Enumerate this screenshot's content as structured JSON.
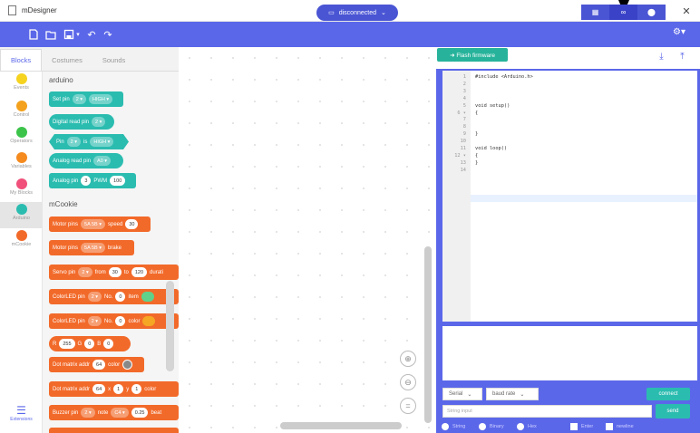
{
  "window": {
    "title": "mDesigner",
    "controls": [
      "–",
      "☐",
      "✕"
    ]
  },
  "toolbar": {
    "connection_label": "disconnected",
    "modes": [
      "▦",
      "∞",
      "⬤"
    ],
    "accent": "#5b67e9"
  },
  "left_tabs": [
    "Blocks",
    "Costumes",
    "Sounds"
  ],
  "categories": [
    {
      "label": "Events",
      "color": "#f5d31f"
    },
    {
      "label": "Control",
      "color": "#f4a11d"
    },
    {
      "label": "Operators",
      "color": "#3cc44a"
    },
    {
      "label": "Variables",
      "color": "#f58a1f"
    },
    {
      "label": "My Blocks",
      "color": "#f0507a"
    },
    {
      "label": "Arduino",
      "color": "#2bbcb0"
    },
    {
      "label": "mCookie",
      "color": "#f26a2a"
    }
  ],
  "extensions_label": "Extensions",
  "palette": {
    "section_arduino": "arduino",
    "section_mcookie": "mCookie",
    "blocks": {
      "set_pin": {
        "text": "Set pin",
        "pin": "2 ▾",
        "level": "HIGH ▾"
      },
      "digital_read": {
        "text": "Digital read pin",
        "pin": "2 ▾"
      },
      "pin_is": {
        "text": "Pin",
        "pin": "2 ▾",
        "is": "is",
        "level": "HIGH ▾"
      },
      "analog_read": {
        "text": "Analog read pin",
        "pin": "A0 ▾"
      },
      "analog_pwm": {
        "text": "Analog pin",
        "pin": "3",
        "pwm": "PWM",
        "val": "100"
      },
      "motor_speed": {
        "text": "Motor pins",
        "pins": "5A 5B ▾",
        "speed": "speed",
        "val": "30"
      },
      "motor_brake": {
        "text": "Motor pins",
        "pins": "5A 5B ▾",
        "brake": "brake"
      },
      "servo": {
        "text": "Servo pin",
        "pin": "2 ▾",
        "from": "from",
        "a": "30",
        "to": "to",
        "b": "120",
        "dur": "durati"
      },
      "color_led_item": {
        "text": "ColorLED pin",
        "pin": "2 ▾",
        "no": "No.",
        "n": "0",
        "item": "item"
      },
      "color_led_color": {
        "text": "ColorLED pin",
        "pin": "2 ▾",
        "no": "No.",
        "n": "0",
        "color": "color"
      },
      "rgb": {
        "r_lbl": "R",
        "r": "255",
        "g_lbl": "G",
        "g": "0",
        "b_lbl": "B",
        "b": "0"
      },
      "dot_matrix_color": {
        "text": "Dot matrix addr",
        "addr": "64",
        "color": "color"
      },
      "dot_matrix_xy": {
        "text": "Dot matrix addr",
        "addr": "64",
        "x_lbl": "x",
        "x": "1",
        "y_lbl": "y",
        "y": "1",
        "color": "color"
      },
      "buzzer": {
        "text": "Buzzer pin",
        "pin": "2 ▾",
        "note": "note",
        "n": "C4 ▾",
        "val": "0.25",
        "beat": "beat"
      }
    }
  },
  "right_panel": {
    "flash_label": "➜ Flash firmware",
    "code_line_numbers": [
      "1",
      "2",
      "3",
      "4",
      "5",
      "6 ▾",
      "7",
      "8",
      "9",
      "10",
      "11",
      "12 ▾",
      "13",
      "14"
    ],
    "code_lines": [
      "#include <Arduino.h>",
      "",
      "",
      "",
      "void setup()",
      "{",
      "",
      "",
      "}",
      "",
      "void loop()",
      "{",
      "}",
      ""
    ],
    "serial_select": "Serial",
    "baud_select": "baud rate",
    "connect_label": "connect",
    "string_placeholder": "String input",
    "send_label": "send",
    "options": [
      "String",
      "Binary",
      "Hex",
      "Enter",
      "newline"
    ]
  }
}
